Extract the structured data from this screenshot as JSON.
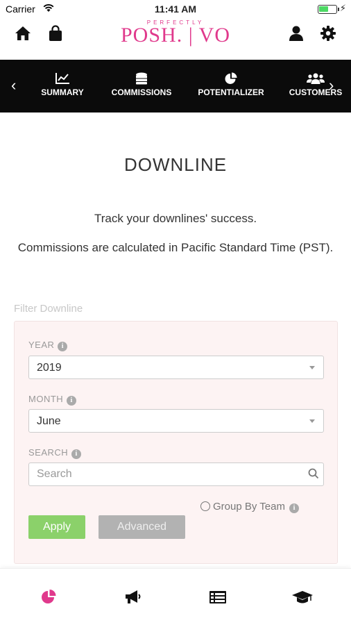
{
  "status_bar": {
    "carrier": "Carrier",
    "time": "11:41 AM",
    "battery_level": 0.55,
    "battery_color": "#4cd964"
  },
  "header": {
    "logo_tagline": "PERFECTLY",
    "logo_text": "POSH. | VO",
    "icons": [
      "home-icon",
      "shopping-bag-icon",
      "user-icon",
      "gear-icon"
    ]
  },
  "nav": {
    "prev_arrow": "‹",
    "next_arrow": "›",
    "items": [
      {
        "label": "SUMMARY",
        "icon": "line-chart-icon"
      },
      {
        "label": "COMMISSIONS",
        "icon": "coins-icon"
      },
      {
        "label": "POTENTIALIZER",
        "icon": "pie-chart-icon"
      },
      {
        "label": "CUSTOMERS",
        "icon": "users-icon"
      }
    ]
  },
  "page": {
    "title": "DOWNLINE",
    "intro_line1": "Track your downlines' success.",
    "intro_line2": "Commissions are calculated in Pacific Standard Time (PST)."
  },
  "filter": {
    "label": "Filter Downline",
    "year": {
      "label": "YEAR",
      "value": "2019"
    },
    "month": {
      "label": "MONTH",
      "value": "June"
    },
    "search": {
      "label": "SEARCH",
      "placeholder": "Search",
      "value": ""
    },
    "group_by_team": {
      "label": "Group By Team",
      "checked": false
    },
    "apply_label": "Apply",
    "advanced_label": "Advanced"
  },
  "tabbar": {
    "active_color": "#e0398c",
    "items": [
      "pie-chart-icon",
      "megaphone-icon",
      "table-icon",
      "graduation-cap-icon"
    ]
  },
  "colors": {
    "brand": "#e0398c",
    "apply": "#8bd16a",
    "nav_bg": "#0b0b0b"
  }
}
